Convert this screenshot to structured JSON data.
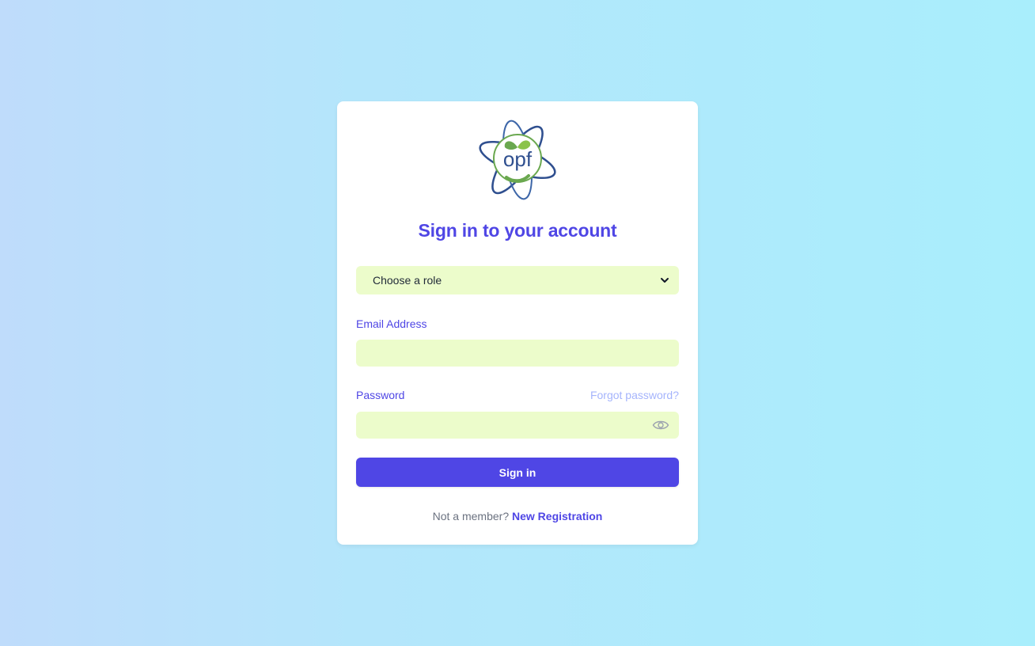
{
  "brand": {
    "logo_text": "opf",
    "logo_icon": "atom-leaf-logo",
    "colors": {
      "logo_blue": "#2f4f8f",
      "logo_green": "#6aa84f"
    }
  },
  "form": {
    "title": "Sign in to your account",
    "role_select": {
      "selected": "Choose a role",
      "icon": "chevron-down-icon"
    },
    "email": {
      "label": "Email Address",
      "value": "",
      "placeholder": ""
    },
    "password": {
      "label": "Password",
      "value": "",
      "placeholder": "",
      "forgot_label": "Forgot password?",
      "toggle_icon": "eye-icon"
    },
    "submit_label": "Sign in",
    "footer": {
      "prompt": "Not a member?",
      "link_label": "New Registration"
    }
  },
  "colors": {
    "primary": "#4f46e5",
    "input_bg": "#ecfccb",
    "link_light": "#a5b4fc",
    "muted": "#6b7280"
  }
}
